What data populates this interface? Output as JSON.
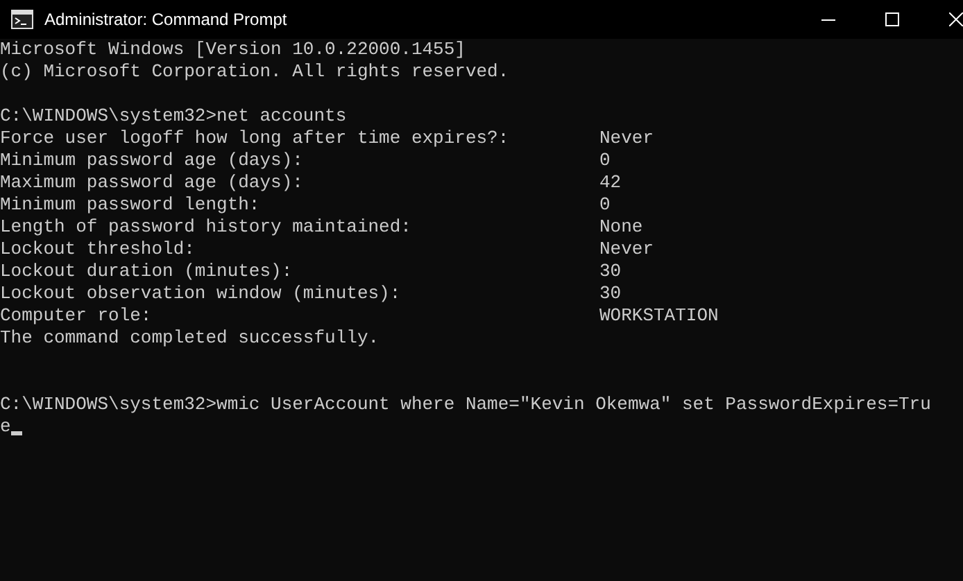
{
  "window": {
    "title": "Administrator: Command Prompt"
  },
  "console": [
    {
      "kind": "text",
      "text": "Microsoft Windows [Version 10.0.22000.1455]"
    },
    {
      "kind": "text",
      "text": "(c) Microsoft Corporation. All rights reserved."
    },
    {
      "kind": "blank"
    },
    {
      "kind": "text",
      "text": "C:\\WINDOWS\\system32>net accounts"
    },
    {
      "kind": "pair",
      "label": "Force user logoff how long after time expires?:",
      "value": "Never"
    },
    {
      "kind": "pair",
      "label": "Minimum password age (days):",
      "value": "0"
    },
    {
      "kind": "pair",
      "label": "Maximum password age (days):",
      "value": "42"
    },
    {
      "kind": "pair",
      "label": "Minimum password length:",
      "value": "0"
    },
    {
      "kind": "pair",
      "label": "Length of password history maintained:",
      "value": "None"
    },
    {
      "kind": "pair",
      "label": "Lockout threshold:",
      "value": "Never"
    },
    {
      "kind": "pair",
      "label": "Lockout duration (minutes):",
      "value": "30"
    },
    {
      "kind": "pair",
      "label": "Lockout observation window (minutes):",
      "value": "30"
    },
    {
      "kind": "pair",
      "label": "Computer role:",
      "value": "WORKSTATION"
    },
    {
      "kind": "text",
      "text": "The command completed successfully."
    },
    {
      "kind": "blank"
    },
    {
      "kind": "blank"
    },
    {
      "kind": "text",
      "text": "C:\\WINDOWS\\system32>wmic UserAccount where Name=\"Kevin Okemwa\" set PasswordExpires=Tru"
    },
    {
      "kind": "text",
      "text": "e",
      "cursor": true
    }
  ]
}
